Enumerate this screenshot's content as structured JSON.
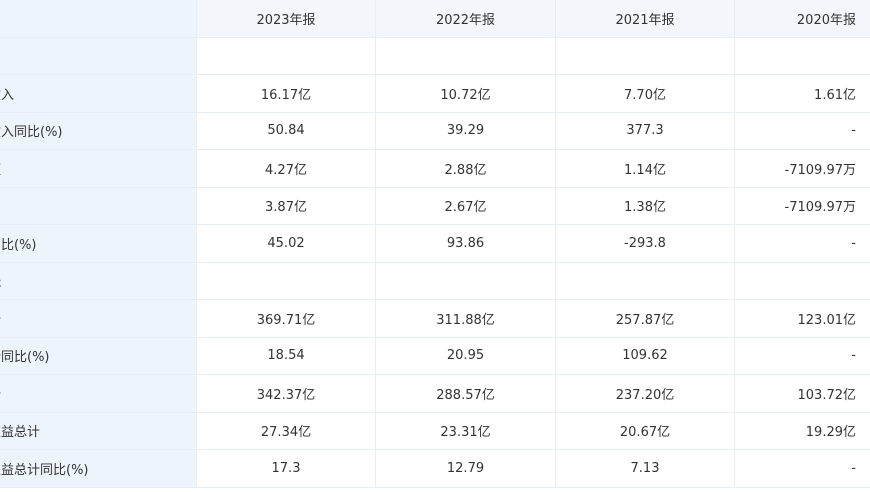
{
  "headers": [
    "2023年报",
    "2022年报",
    "2021年报",
    "2020年报"
  ],
  "rows": [
    {
      "type": "section",
      "label": "",
      "values": [
        "",
        "",
        "",
        ""
      ]
    },
    {
      "type": "data",
      "label": "收入",
      "values": [
        "16.17亿",
        "10.72亿",
        "7.70亿",
        "1.61亿"
      ]
    },
    {
      "type": "data",
      "label": "收入同比(%)",
      "values": [
        "50.84",
        "39.29",
        "377.3",
        "-"
      ]
    },
    {
      "type": "data",
      "label": "额",
      "values": [
        "4.27亿",
        "2.88亿",
        "1.14亿",
        "-7109.97万"
      ]
    },
    {
      "type": "data",
      "label": "",
      "values": [
        "3.87亿",
        "2.67亿",
        "1.38亿",
        "-7109.97万"
      ]
    },
    {
      "type": "data",
      "label": "同比(%)",
      "values": [
        "45.02",
        "93.86",
        "-293.8",
        "-"
      ]
    },
    {
      "type": "section",
      "label": "表",
      "values": [
        "",
        "",
        "",
        ""
      ]
    },
    {
      "type": "data",
      "label": "计",
      "values": [
        "369.71亿",
        "311.88亿",
        "257.87亿",
        "123.01亿"
      ]
    },
    {
      "type": "data",
      "label": "计同比(%)",
      "values": [
        "18.54",
        "20.95",
        "109.62",
        "-"
      ]
    },
    {
      "type": "data",
      "label": "计",
      "values": [
        "342.37亿",
        "288.57亿",
        "237.20亿",
        "103.72亿"
      ]
    },
    {
      "type": "data",
      "label": "权益总计",
      "values": [
        "27.34亿",
        "23.31亿",
        "20.67亿",
        "19.29亿"
      ]
    },
    {
      "type": "data",
      "label": "权益总计同比(%)",
      "values": [
        "17.3",
        "12.79",
        "7.13",
        "-"
      ]
    }
  ]
}
